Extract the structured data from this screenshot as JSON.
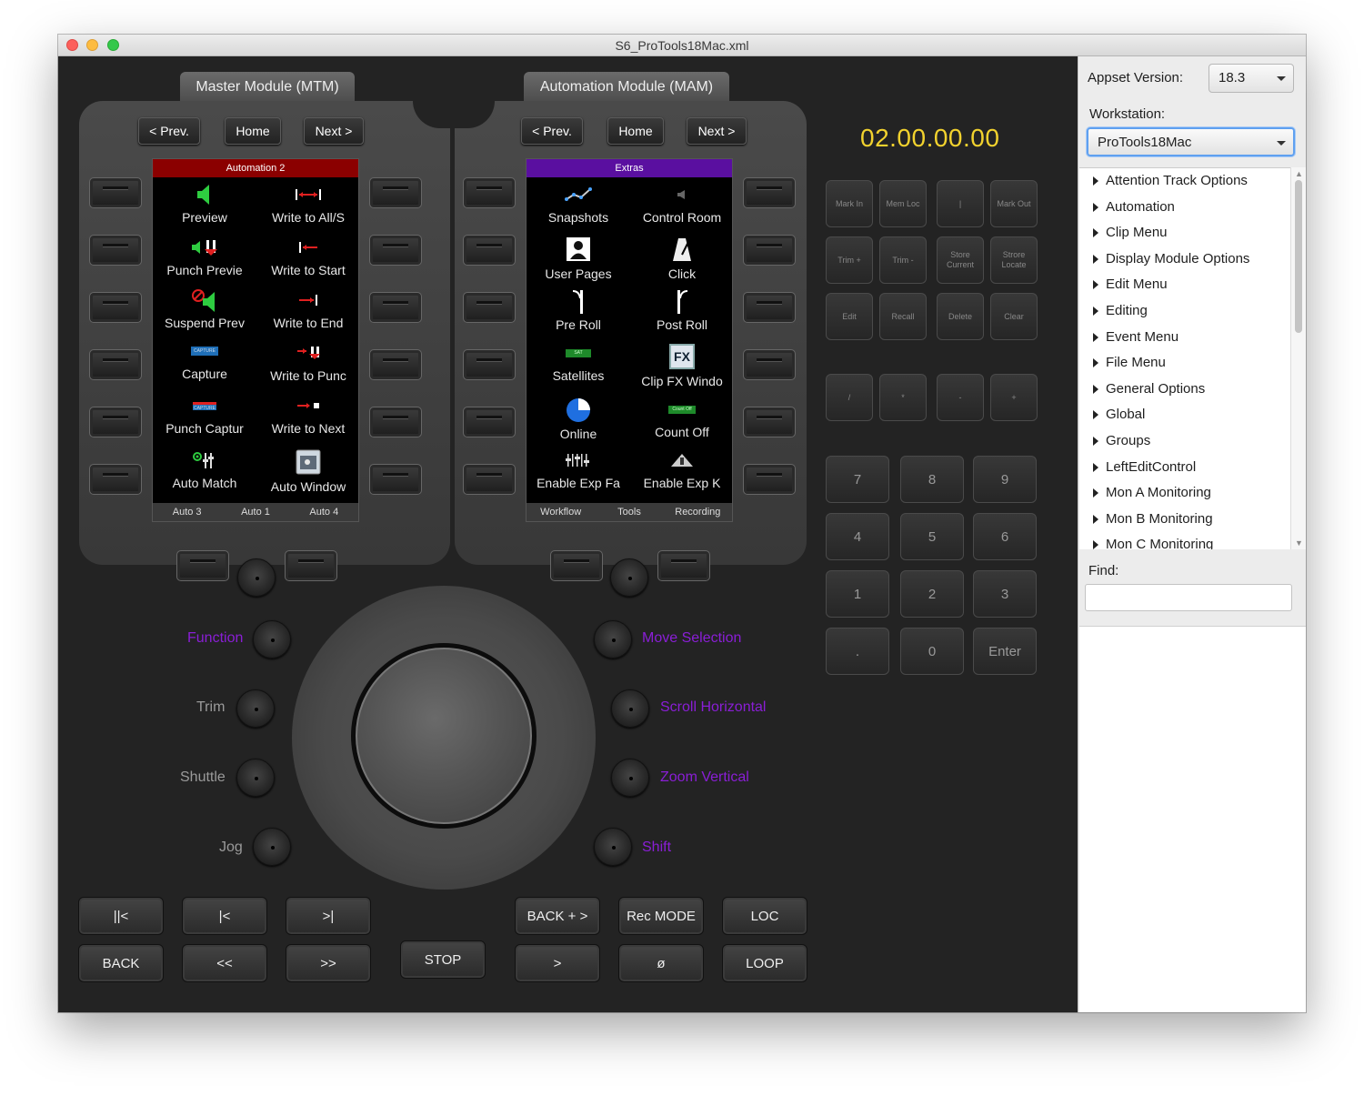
{
  "window": {
    "title": "S6_ProTools18Mac.xml",
    "traffic_colors": [
      "#fc605c",
      "#fdbc40",
      "#34c84a"
    ]
  },
  "tabs": {
    "master": "Master Module (MTM)",
    "automation": "Automation Module (MAM)"
  },
  "left_nav": {
    "prev": "< Prev.",
    "home": "Home",
    "next": "Next >"
  },
  "right_nav": {
    "prev": "< Prev.",
    "home": "Home",
    "next": "Next >"
  },
  "left_screen": {
    "header": "Automation 2",
    "header_color": "#8b0000",
    "cells": [
      "Preview",
      "Write to All/S",
      "Punch Previe",
      "Write to Start",
      "Suspend Prev",
      "Write to End",
      "Capture",
      "Write to Punc",
      "Punch Captur",
      "Write to Next",
      "Auto Match",
      "Auto Window"
    ],
    "footer": [
      "Auto 3",
      "Auto 1",
      "Auto 4"
    ]
  },
  "right_screen": {
    "header": "Extras",
    "header_color": "#5a0fa0",
    "cells": [
      "Snapshots",
      "Control Room",
      "User Pages",
      "Click",
      "Pre Roll",
      "Post Roll",
      "Satellites",
      "Clip FX Windo",
      "Online",
      "Count Off",
      "Enable Exp Fa",
      "Enable Exp K"
    ],
    "footer": [
      "Workflow",
      "Tools",
      "Recording"
    ],
    "icon_texts": {
      "satellites": "SAT",
      "count_off": "Count Off",
      "fx": "FX"
    }
  },
  "capture_icon_text": "CAPTURE",
  "knob_labels": {
    "function": "Function",
    "trim": "Trim",
    "shuttle": "Shuttle",
    "jog": "Jog",
    "move_selection": "Move Selection",
    "scroll_horizontal": "Scroll Horizontal",
    "zoom_vertical": "Zoom Vertical",
    "shift": "Shift"
  },
  "label_colors": {
    "purple": "#8a1ed6",
    "grey": "#9a9a9a"
  },
  "timecode": {
    "value": "02.00.00.00",
    "color": "#f2d22e"
  },
  "keypad_row1": [
    "Mark In",
    "Mem Loc",
    "|",
    "Mark Out"
  ],
  "keypad_row2": [
    "Trim +",
    "Trim -",
    "Store Current",
    "Strore Locate"
  ],
  "keypad_row3": [
    "Edit",
    "Recall",
    "Delete",
    "Clear"
  ],
  "keypad_row4": [
    "/",
    "*",
    "-",
    "+"
  ],
  "numpad": [
    "7",
    "8",
    "9",
    "4",
    "5",
    "6",
    "1",
    "2",
    "3",
    ".",
    "0",
    "Enter"
  ],
  "transport_left": [
    "||<",
    "|<",
    ">|",
    "BACK",
    "<<",
    ">>"
  ],
  "transport_stop": "STOP",
  "transport_right": [
    "BACK + >",
    "Rec MODE",
    "LOC",
    ">",
    "ø",
    "LOOP"
  ],
  "sidebar": {
    "appset_label": "Appset Version:",
    "appset_value": "18.3",
    "workstation_label": "Workstation:",
    "workstation_value": "ProTools18Mac",
    "tree": [
      "Attention Track Options",
      "Automation",
      "Clip Menu",
      "Display Module Options",
      "Edit Menu",
      "Editing",
      "Event Menu",
      "File Menu",
      "General Options",
      "Global",
      "Groups",
      "LeftEditControl",
      "Mon A Monitoring",
      "Mon B Monitoring",
      "Mon C Monitoring"
    ],
    "find_label": "Find:",
    "find_value": ""
  }
}
